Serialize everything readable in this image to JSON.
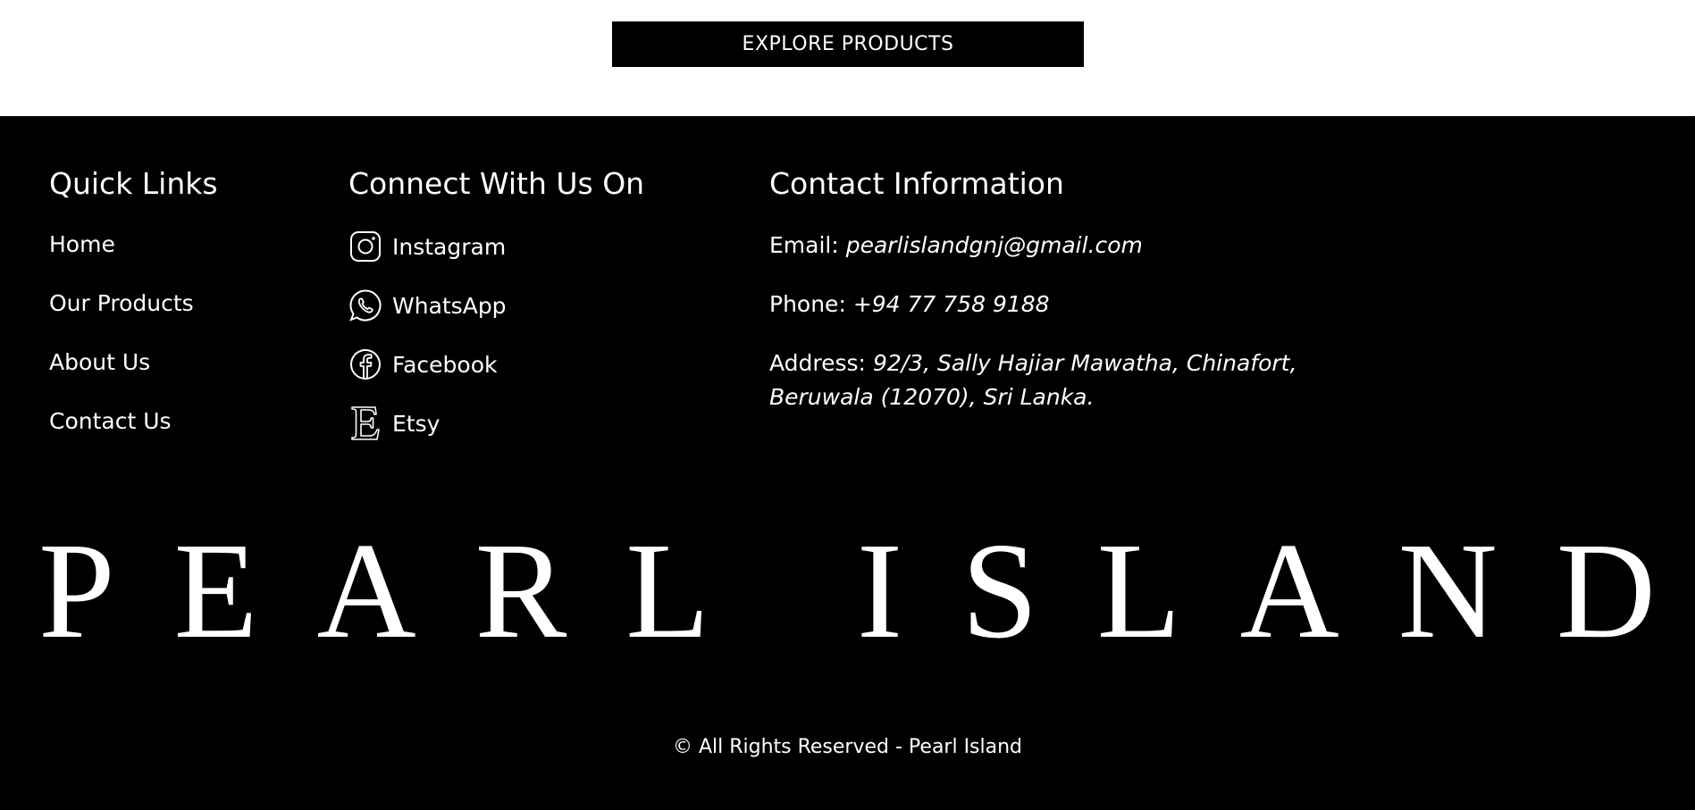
{
  "hero": {
    "explore_label": "EXPLORE PRODUCTS"
  },
  "footer": {
    "quick_links": {
      "heading": "Quick Links",
      "items": [
        "Home",
        "Our Products",
        "About Us",
        "Contact Us"
      ]
    },
    "connect": {
      "heading": "Connect With Us On",
      "items": [
        {
          "label": "Instagram",
          "icon": "instagram-icon"
        },
        {
          "label": "WhatsApp",
          "icon": "whatsapp-icon"
        },
        {
          "label": "Facebook",
          "icon": "facebook-icon"
        },
        {
          "label": "Etsy",
          "icon": "etsy-icon"
        }
      ]
    },
    "contact": {
      "heading": "Contact Information",
      "email_label": "Email: ",
      "email_value": "pearlislandgnj@gmail.com",
      "phone_label": "Phone: ",
      "phone_value": "+94 77 758 9188",
      "address_label": "Address: ",
      "address_value_line1": "92/3, Sally Hajiar Mawatha, Chinafort,",
      "address_value_line2": "Beruwala (12070), Sri Lanka."
    },
    "brand_wordmark": "PEARL ISLAND",
    "copyright": "© All Rights Reserved - Pearl Island"
  },
  "colors": {
    "background": "#000000",
    "top_band": "#ffffff",
    "text": "#ffffff"
  }
}
